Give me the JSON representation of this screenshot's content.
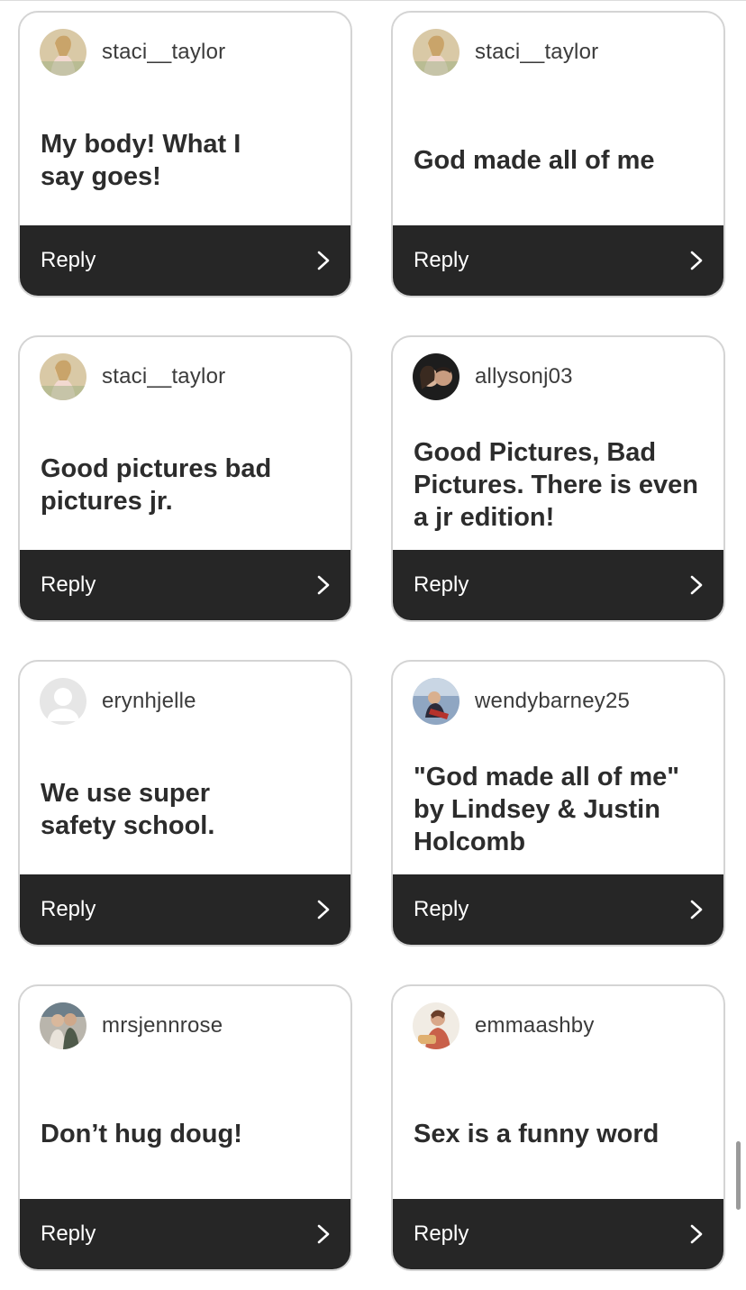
{
  "cards": [
    {
      "username": "staci__taylor",
      "text": "My body! What I say goes!",
      "reply": "Reply",
      "avatar": "staci-avatar"
    },
    {
      "username": "staci__taylor",
      "text": "God made all of me",
      "reply": "Reply",
      "avatar": "staci-avatar"
    },
    {
      "username": "staci__taylor",
      "text": "Good pictures bad pictures jr.",
      "reply": "Reply",
      "avatar": "staci-avatar"
    },
    {
      "username": "allysonj03",
      "text": "Good Pictures, Bad Pictures. There is even a jr edition!",
      "reply": "Reply",
      "avatar": "allyson-avatar"
    },
    {
      "username": "erynhjelle",
      "text": "We use super safety school.",
      "reply": "Reply",
      "avatar": "default-avatar"
    },
    {
      "username": "wendybarney25",
      "text": "\"God made all of me\" by Lindsey & Justin Holcomb",
      "reply": "Reply",
      "avatar": "wendy-avatar"
    },
    {
      "username": "mrsjennrose",
      "text": "Don’t hug doug!",
      "reply": "Reply",
      "avatar": "jenn-avatar"
    },
    {
      "username": "emmaashby",
      "text": "Sex is a funny word",
      "reply": "Reply",
      "avatar": "emma-avatar"
    }
  ],
  "icons": {
    "reply": "chevron-right-icon"
  },
  "colors": {
    "reply_bar": "#262626",
    "card_border": "#d4d4d4",
    "text": "#2c2c2c"
  }
}
